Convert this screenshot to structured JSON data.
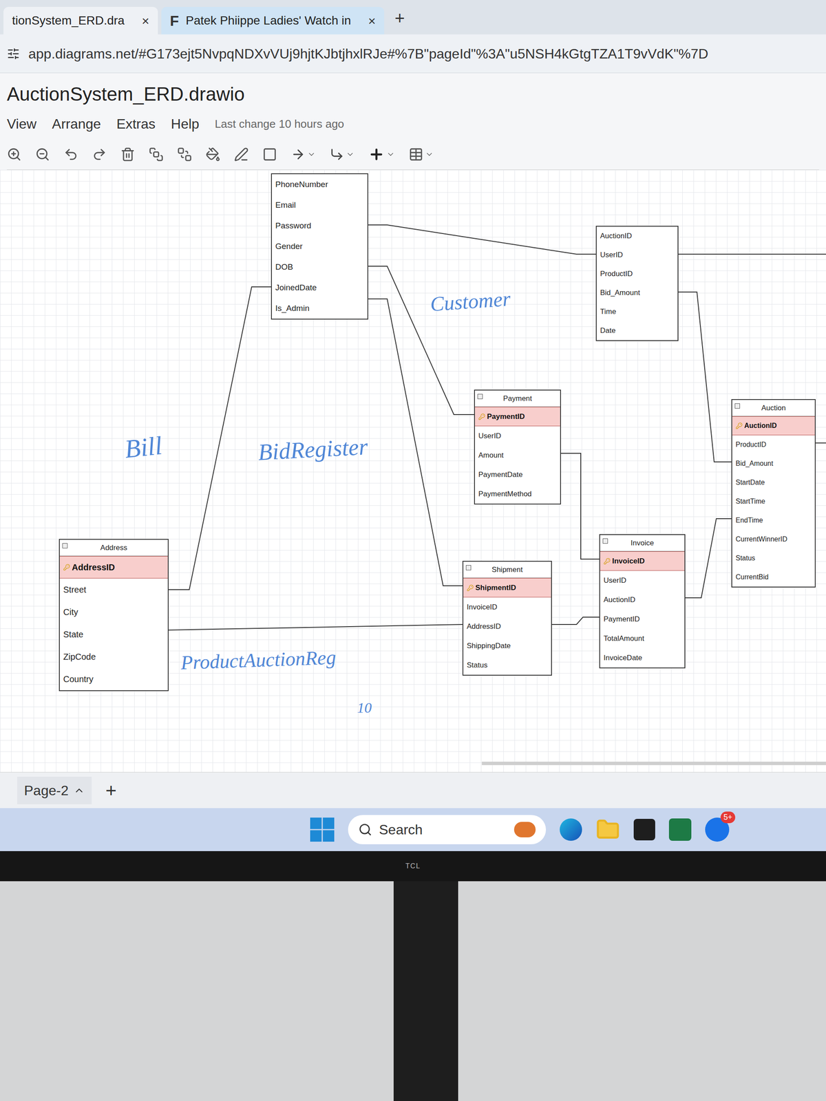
{
  "browser": {
    "tabs": [
      {
        "label": "tionSystem_ERD.dra",
        "close": "×",
        "selected": true,
        "favicon": ""
      },
      {
        "label": "Patek Phiippe Ladies' Watch in",
        "close": "×",
        "selected": false,
        "favicon": "F"
      }
    ],
    "new_tab": "+",
    "url": "app.diagrams.net/#G173ejt5NvpqNDXvVUj9hjtKJbtjhxlRJe#%7B\"pageId\"%3A\"u5NSH4kGtgTZA1T9vVdK\"%7D"
  },
  "app": {
    "title": "AuctionSystem_ERD.drawio",
    "menu": [
      "View",
      "Arrange",
      "Extras",
      "Help"
    ],
    "last_change": "Last change 10 hours ago"
  },
  "entities": [
    {
      "title": "",
      "fields": [
        {
          "name": "PhoneNumber",
          "pk": false
        },
        {
          "name": "Email",
          "pk": false
        },
        {
          "name": "Password",
          "pk": false
        },
        {
          "name": "Gender",
          "pk": false
        },
        {
          "name": "DOB",
          "pk": false
        },
        {
          "name": "JoinedDate",
          "pk": false
        },
        {
          "name": "Is_Admin",
          "pk": false
        }
      ]
    },
    {
      "title": "",
      "fields": [
        {
          "name": "AuctionID",
          "pk": false
        },
        {
          "name": "UserID",
          "pk": false
        },
        {
          "name": "ProductID",
          "pk": false
        },
        {
          "name": "Bid_Amount",
          "pk": false
        },
        {
          "name": "Time",
          "pk": false
        },
        {
          "name": "Date",
          "pk": false
        }
      ]
    },
    {
      "title": "Payment",
      "fields": [
        {
          "name": "PaymentID",
          "pk": true
        },
        {
          "name": "UserID",
          "pk": false
        },
        {
          "name": "Amount",
          "pk": false
        },
        {
          "name": "PaymentDate",
          "pk": false
        },
        {
          "name": "PaymentMethod",
          "pk": false
        }
      ]
    },
    {
      "title": "Auction",
      "fields": [
        {
          "name": "AuctionID",
          "pk": true
        },
        {
          "name": "ProductID",
          "pk": false
        },
        {
          "name": "Bid_Amount",
          "pk": false
        },
        {
          "name": "StartDate",
          "pk": false
        },
        {
          "name": "StartTime",
          "pk": false
        },
        {
          "name": "EndTime",
          "pk": false
        },
        {
          "name": "CurrentWinnerID",
          "pk": false
        },
        {
          "name": "Status",
          "pk": false
        },
        {
          "name": "CurrentBid",
          "pk": false
        }
      ]
    },
    {
      "title": "Invoice",
      "fields": [
        {
          "name": "InvoiceID",
          "pk": true
        },
        {
          "name": "UserID",
          "pk": false
        },
        {
          "name": "AuctionID",
          "pk": false
        },
        {
          "name": "PaymentID",
          "pk": false
        },
        {
          "name": "TotalAmount",
          "pk": false
        },
        {
          "name": "InvoiceDate",
          "pk": false
        }
      ]
    },
    {
      "title": "Shipment",
      "fields": [
        {
          "name": "ShipmentID",
          "pk": true
        },
        {
          "name": "InvoiceID",
          "pk": false
        },
        {
          "name": "AddressID",
          "pk": false
        },
        {
          "name": "ShippingDate",
          "pk": false
        },
        {
          "name": "Status",
          "pk": false
        }
      ]
    },
    {
      "title": "Address",
      "fields": [
        {
          "name": "AddressID",
          "pk": true
        },
        {
          "name": "Street",
          "pk": false
        },
        {
          "name": "City",
          "pk": false
        },
        {
          "name": "State",
          "pk": false
        },
        {
          "name": "ZipCode",
          "pk": false
        },
        {
          "name": "Country",
          "pk": false
        }
      ]
    }
  ],
  "annotations": [
    "Bill",
    "BidRegister",
    "Customer",
    "ProductAuctionReg",
    "10"
  ],
  "pages": [
    {
      "label": "Page-2",
      "selected": true
    }
  ],
  "add_page": "+",
  "taskbar": {
    "search": "Search",
    "badge": "5+"
  },
  "monitor": {
    "brand": "TCL"
  }
}
